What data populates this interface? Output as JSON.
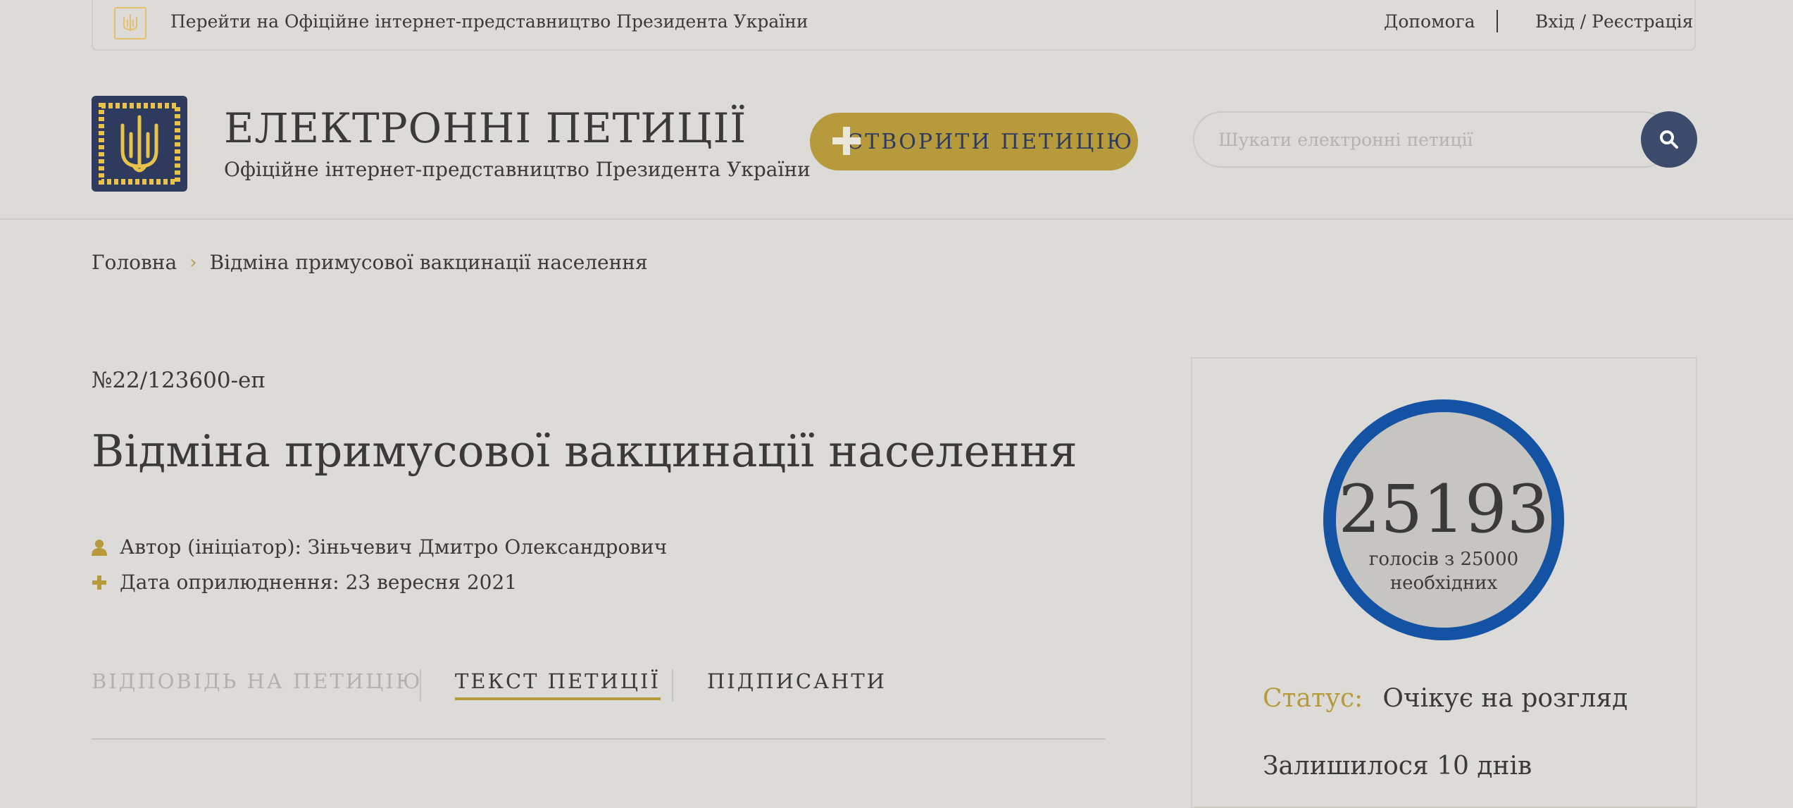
{
  "topbar": {
    "president_link": "Перейти на Офіційне інтернет-представництво Президента України",
    "help": "Допомога",
    "login": "Вхід / Реєстрація"
  },
  "header": {
    "title": "ЕЛЕКТРОННІ ПЕТИЦІЇ",
    "subtitle": "Офіційне інтернет-представництво Президента України",
    "create_button": "СТВОРИТИ ПЕТИЦІЮ",
    "search_placeholder": "Шукати електронні петиції"
  },
  "breadcrumb": {
    "home": "Головна",
    "current": "Відміна примусової вакцинації населення"
  },
  "petition": {
    "number": "№22/123600-еп",
    "title": "Відміна примусової вакцинації населення",
    "author": "Автор (ініціатор): Зіньчевич Дмитро Олександрович",
    "date": "Дата оприлюднення: 23 вересня 2021"
  },
  "tabs": [
    {
      "label": "ВІДПОВІДЬ НА ПЕТИЦІЮ"
    },
    {
      "label": "ТЕКСТ ПЕТИЦІЇ"
    },
    {
      "label": "ПІДПИСАНТИ"
    }
  ],
  "side": {
    "votes": "25193",
    "votes_label": "голосів з 25000 необхідних",
    "status_key": "Статус:",
    "status_value": "Очікує на розгляд",
    "remaining": "Залишилося 10 днів"
  },
  "colors": {
    "background": "#dcdbd8",
    "accent_gold": "#b79a3b",
    "navy": "#2e3b5e",
    "progress_blue": "#1453a3"
  }
}
